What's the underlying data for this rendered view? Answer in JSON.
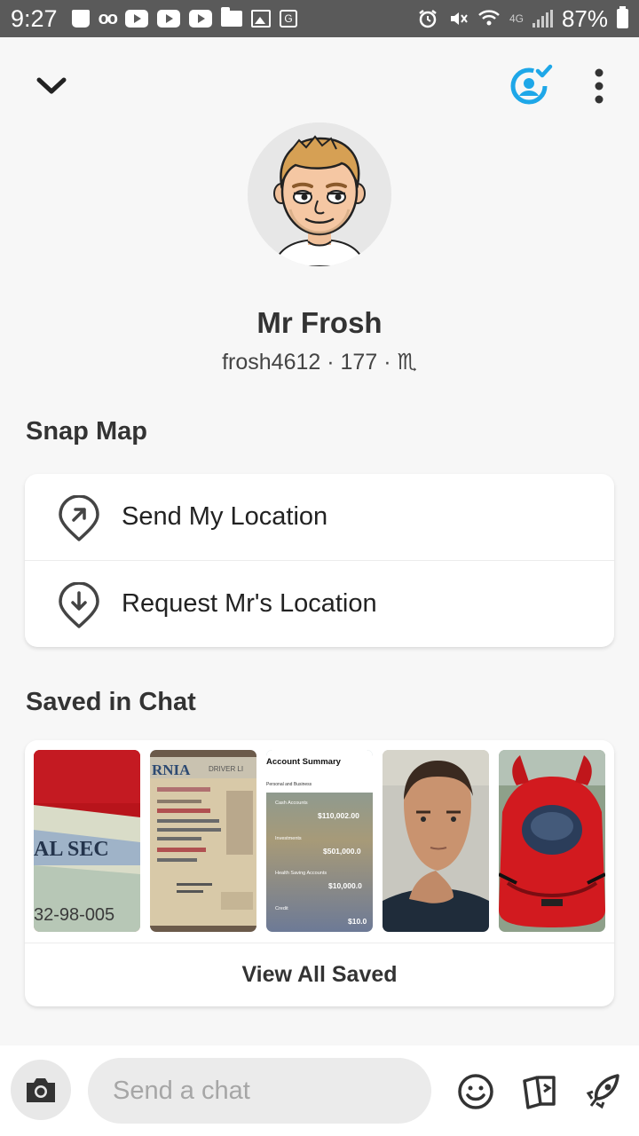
{
  "status_bar": {
    "time": "9:27",
    "network": "4G",
    "battery": "87%"
  },
  "profile": {
    "display_name": "Mr Frosh",
    "username": "frosh4612",
    "score": "177",
    "zodiac": "♏",
    "separator": "·"
  },
  "snap_map": {
    "title": "Snap Map",
    "items": [
      {
        "label": "Send My Location",
        "icon": "location-arrow-icon"
      },
      {
        "label": "Request Mr's Location",
        "icon": "location-request-icon"
      }
    ]
  },
  "saved_in_chat": {
    "title": "Saved in Chat",
    "thumbnails": [
      {
        "name": "thumbnail-social-security-card",
        "partial_text": [
          "AL SEC",
          "32-98-005"
        ]
      },
      {
        "name": "thumbnail-drivers-license",
        "partial_text": [
          "RNIA",
          "DRIVER LI"
        ]
      },
      {
        "name": "thumbnail-account-summary",
        "partial_text": [
          "Account Summary",
          "Personal and Business",
          "Cash Accounts",
          "$110,002.00",
          "Investments",
          "$501,000.0",
          "Health Saving Accounts",
          "$10,000.0",
          "Credit",
          "$10.0"
        ]
      },
      {
        "name": "thumbnail-selfie"
      },
      {
        "name": "thumbnail-red-car"
      }
    ],
    "view_all_label": "View All Saved"
  },
  "bottom_bar": {
    "chat_placeholder": "Send a chat"
  },
  "colors": {
    "accent_blue": "#1ea7e8",
    "status_bar_bg": "#5a5a5a",
    "page_bg": "#f7f7f7"
  }
}
